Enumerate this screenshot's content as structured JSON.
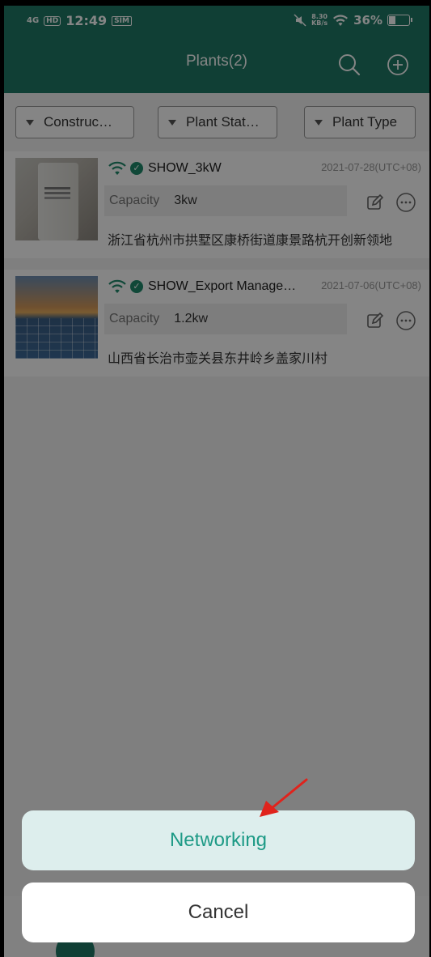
{
  "status_bar": {
    "network": "4G",
    "hd": "HD",
    "time": "12:49",
    "sim_badge": "SIM",
    "speed_value": "8.30",
    "speed_unit": "KB/s",
    "battery": "36%",
    "battery_level": 0.36
  },
  "header": {
    "title": "Plants(2)",
    "search_icon": "search-icon",
    "add_icon": "plus-circle-icon"
  },
  "filters": [
    {
      "label": "Construc…"
    },
    {
      "label": "Plant Stat…"
    },
    {
      "label": "Plant Type"
    }
  ],
  "plants": [
    {
      "name": "SHOW_3kW",
      "date": "2021-07-28(UTC+08)",
      "capacity_label": "Capacity",
      "capacity_value": "3kw",
      "address": "浙江省杭州市拱墅区康桥街道康景路杭开创新领地"
    },
    {
      "name": "SHOW_Export Manage…",
      "date": "2021-07-06(UTC+08)",
      "capacity_label": "Capacity",
      "capacity_value": "1.2kw",
      "address": "山西省长治市壶关县东井岭乡盖家川村"
    }
  ],
  "action_sheet": {
    "networking_label": "Networking",
    "cancel_label": "Cancel"
  },
  "colors": {
    "brand": "#1f7a66",
    "accent_text": "#1d9a86",
    "annotation_arrow": "#e0231c"
  }
}
